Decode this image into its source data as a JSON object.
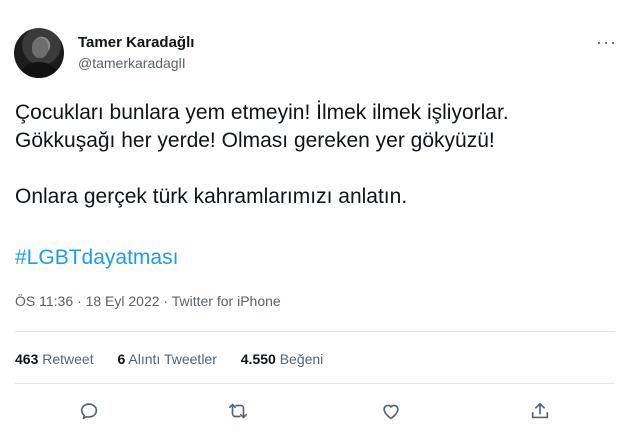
{
  "author": {
    "display_name": "Tamer Karadağlı",
    "handle": "@tamerkaradaglI"
  },
  "more_label": "···",
  "tweet": {
    "lines": [
      "Çocukları bunlara yem etmeyin! İlmek ilmek işliyorlar.",
      "Gökkuşağı her yerde! Olması gereken yer gökyüzü!",
      "Onlara gerçek türk kahramlarımızı anlatın."
    ],
    "hashtag": "#LGBTdayatması"
  },
  "meta": {
    "time": "ÖS 11:36",
    "separator1": " · ",
    "date": "18 Eyl 2022",
    "separator2": " · ",
    "source": "Twitter for iPhone"
  },
  "stats": {
    "retweet_count": "463",
    "retweet_label": "Retweet",
    "quote_count": "6",
    "quote_label": "Alıntı Tweetler",
    "like_count": "4.550",
    "like_label": "Beğeni"
  },
  "icons": {
    "reply": "reply-icon",
    "retweet": "retweet-icon",
    "like": "heart-icon",
    "share": "share-icon"
  },
  "colors": {
    "link": "#1d9bf0",
    "secondary": "#536471",
    "text": "#0f1419"
  }
}
